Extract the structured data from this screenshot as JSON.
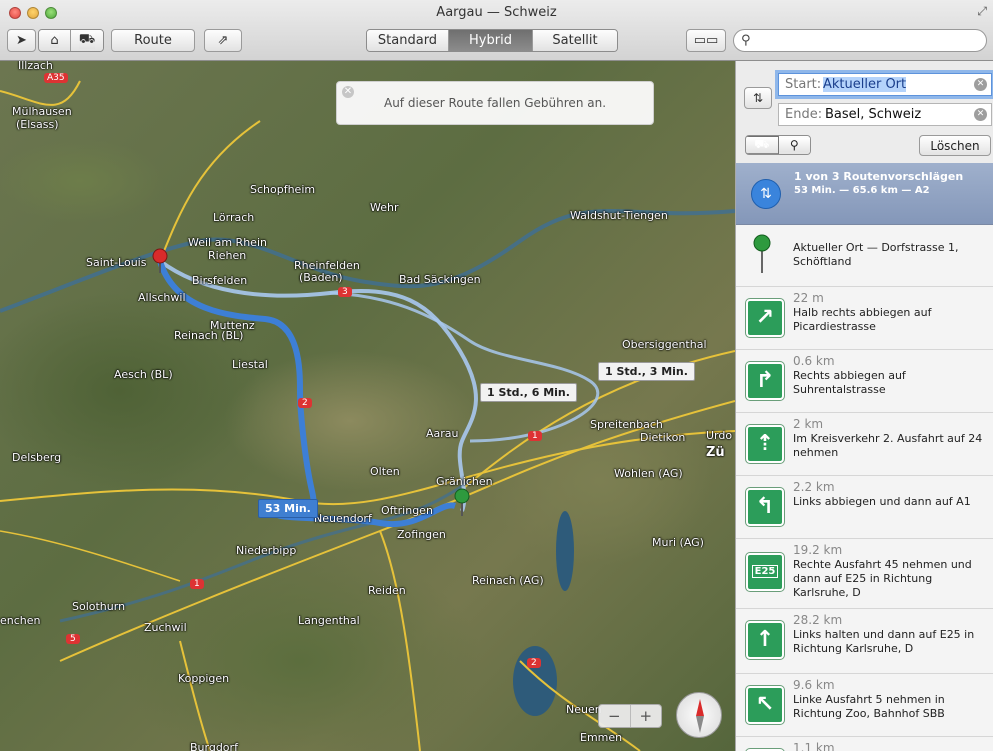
{
  "window": {
    "title": "Aargau — Schweiz"
  },
  "toolbar": {
    "route_label": "Route",
    "views": [
      "Standard",
      "Hybrid",
      "Satellit"
    ],
    "active_view": "Hybrid",
    "search": {
      "value": "",
      "placeholder": ""
    }
  },
  "map": {
    "toll_notice": "Auf dieser Route fallen Gebühren an.",
    "route_callouts": {
      "main": "53 Min.",
      "alt1": "1 Std., 6 Min.",
      "alt2": "1 Std., 3 Min."
    },
    "road_badges": [
      "A35",
      "3",
      "2",
      "1",
      "1",
      "5",
      "2"
    ],
    "places": [
      "Illzach",
      "Mülhausen",
      "(Elsass)",
      "Schopfheim",
      "Lörrach",
      "Weil am Rhein",
      "Riehen",
      "Saint-Louis",
      "Birsfelden",
      "Wehr",
      "Rheinfelden",
      "(Baden)",
      "Bad Säckingen",
      "Waldshut-Tiengen",
      "Allschwil",
      "Muttenz",
      "Reinach (BL)",
      "Liestal",
      "Obersiggenthal",
      "Aesch (BL)",
      "Spreitenbach",
      "Dietikon",
      "Urdo",
      "Delsberg",
      "Aarau",
      "Olten",
      "Gränichen",
      "Wohlen (AG)",
      "Zü",
      "Oftringen",
      "Neuendorf",
      "Zofingen",
      "Niederbipp",
      "Muri (AG)",
      "Reinach (AG)",
      "Reiden",
      "Solothurn",
      "Zuchwil",
      "enchen",
      "Langenthal",
      "Koppigen",
      "Neuen",
      "Emmen",
      "Burgdorf"
    ],
    "zoom_out": "−",
    "zoom_in": "+"
  },
  "sidebar": {
    "start_label": "Start:",
    "start_value": "Aktueller Ort",
    "end_label": "Ende:",
    "end_value": "Basel, Schweiz",
    "clear_label": "Löschen",
    "summary": {
      "title": "1 von 3 Routenvorschlägen",
      "detail": "53 Min. — 65.6 km — A2"
    },
    "start_location": "Aktueller Ort — Dorfstrasse 1, Schöftland",
    "steps": [
      {
        "distance": "22 m",
        "text": "Halb rechts abbiegen auf Picardiestrasse",
        "icon": "bear-right-icon"
      },
      {
        "distance": "0.6 km",
        "text": "Rechts abbiegen auf Suhrentalstrasse",
        "icon": "turn-right-icon"
      },
      {
        "distance": "2 km",
        "text": "Im Kreisverkehr 2. Ausfahrt auf 24 nehmen",
        "icon": "roundabout-icon"
      },
      {
        "distance": "2.2 km",
        "text": "Links abbiegen und dann auf A1",
        "icon": "turn-left-icon"
      },
      {
        "distance": "19.2 km",
        "text": "Rechte Ausfahrt 45 nehmen und dann auf E25 in Richtung Karlsruhe, D",
        "icon": "e25-sign-icon",
        "badge": "E25"
      },
      {
        "distance": "28.2 km",
        "text": "Links halten und dann auf E25 in Richtung Karlsruhe, D",
        "icon": "keep-left-icon"
      },
      {
        "distance": "9.6 km",
        "text": "Linke Ausfahrt 5 nehmen in Richtung Zoo, Bahnhof SBB",
        "icon": "exit-left-icon"
      },
      {
        "distance": "1.1 km",
        "text": "",
        "icon": "straight-icon"
      }
    ]
  },
  "colors": {
    "route_main": "#3d7fd6",
    "route_alt": "#9cc0ea",
    "pin_start": "#2e9a3e",
    "pin_end": "#d92b2b",
    "sign_green": "#2c9d5a"
  }
}
